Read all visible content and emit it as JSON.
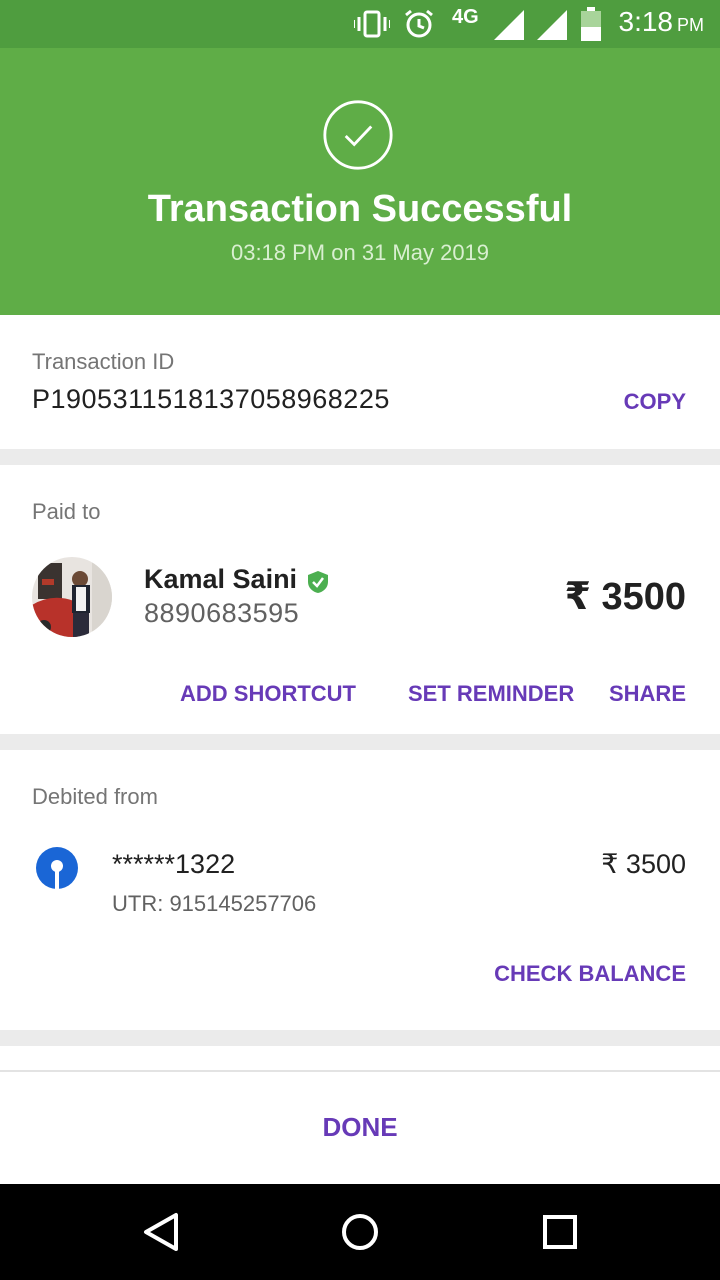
{
  "status_bar": {
    "time": "3:18",
    "ampm": "PM",
    "network": "4G",
    "icons": [
      "vibrate-icon",
      "alarm-icon",
      "signal-icon",
      "signal-icon",
      "battery-icon"
    ]
  },
  "header": {
    "title": "Transaction Successful",
    "subtitle": "03:18 PM on 31 May 2019",
    "icon": "check-circle-icon",
    "bg_color": "#5fad47"
  },
  "transaction": {
    "label": "Transaction ID",
    "id": "P1905311518137058968225",
    "copy_label": "COPY"
  },
  "paid_to": {
    "label": "Paid to",
    "name": "Kamal  Saini",
    "phone": "8890683595",
    "amount": "₹ 3500",
    "verified_icon": "verified-shield-icon",
    "actions": {
      "add_shortcut": "ADD SHORTCUT",
      "set_reminder": "SET REMINDER",
      "share": "SHARE"
    }
  },
  "debited_from": {
    "label": "Debited from",
    "account": "******1322",
    "utr": "UTR: 915145257706",
    "amount": "₹ 3500",
    "bank_icon": "bank-logo-icon",
    "check_balance": "CHECK BALANCE"
  },
  "footer": {
    "done_label": "DONE"
  },
  "accent_color": "#673ab7",
  "nav_bar": {
    "icons": [
      "back-icon",
      "home-icon",
      "recents-icon"
    ]
  }
}
